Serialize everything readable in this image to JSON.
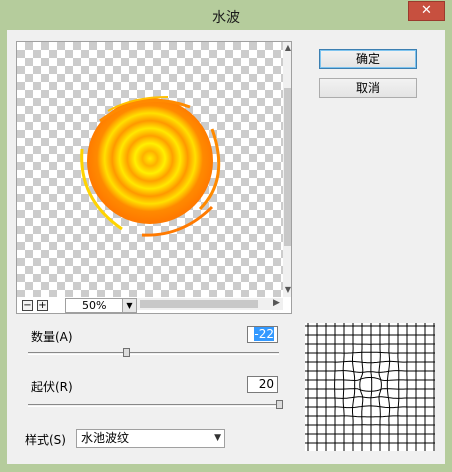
{
  "window": {
    "title": "水波",
    "close_glyph": "✕"
  },
  "buttons": {
    "ok": "确定",
    "cancel": "取消"
  },
  "preview": {
    "zoom_out": "−",
    "zoom_in": "+",
    "zoom": "50%"
  },
  "controls": {
    "amount": {
      "label": "数量(A)",
      "value": "-22",
      "slider_fraction": 0.39
    },
    "ridges": {
      "label": "起伏(R)",
      "value": "20",
      "slider_fraction": 1.0
    },
    "style": {
      "label": "样式(S)",
      "value": "水池波纹"
    }
  },
  "colors": {
    "window_frame": "#b5cc9c",
    "ripple_orange": "#ff8a00",
    "ripple_yellow": "#ffee00"
  }
}
